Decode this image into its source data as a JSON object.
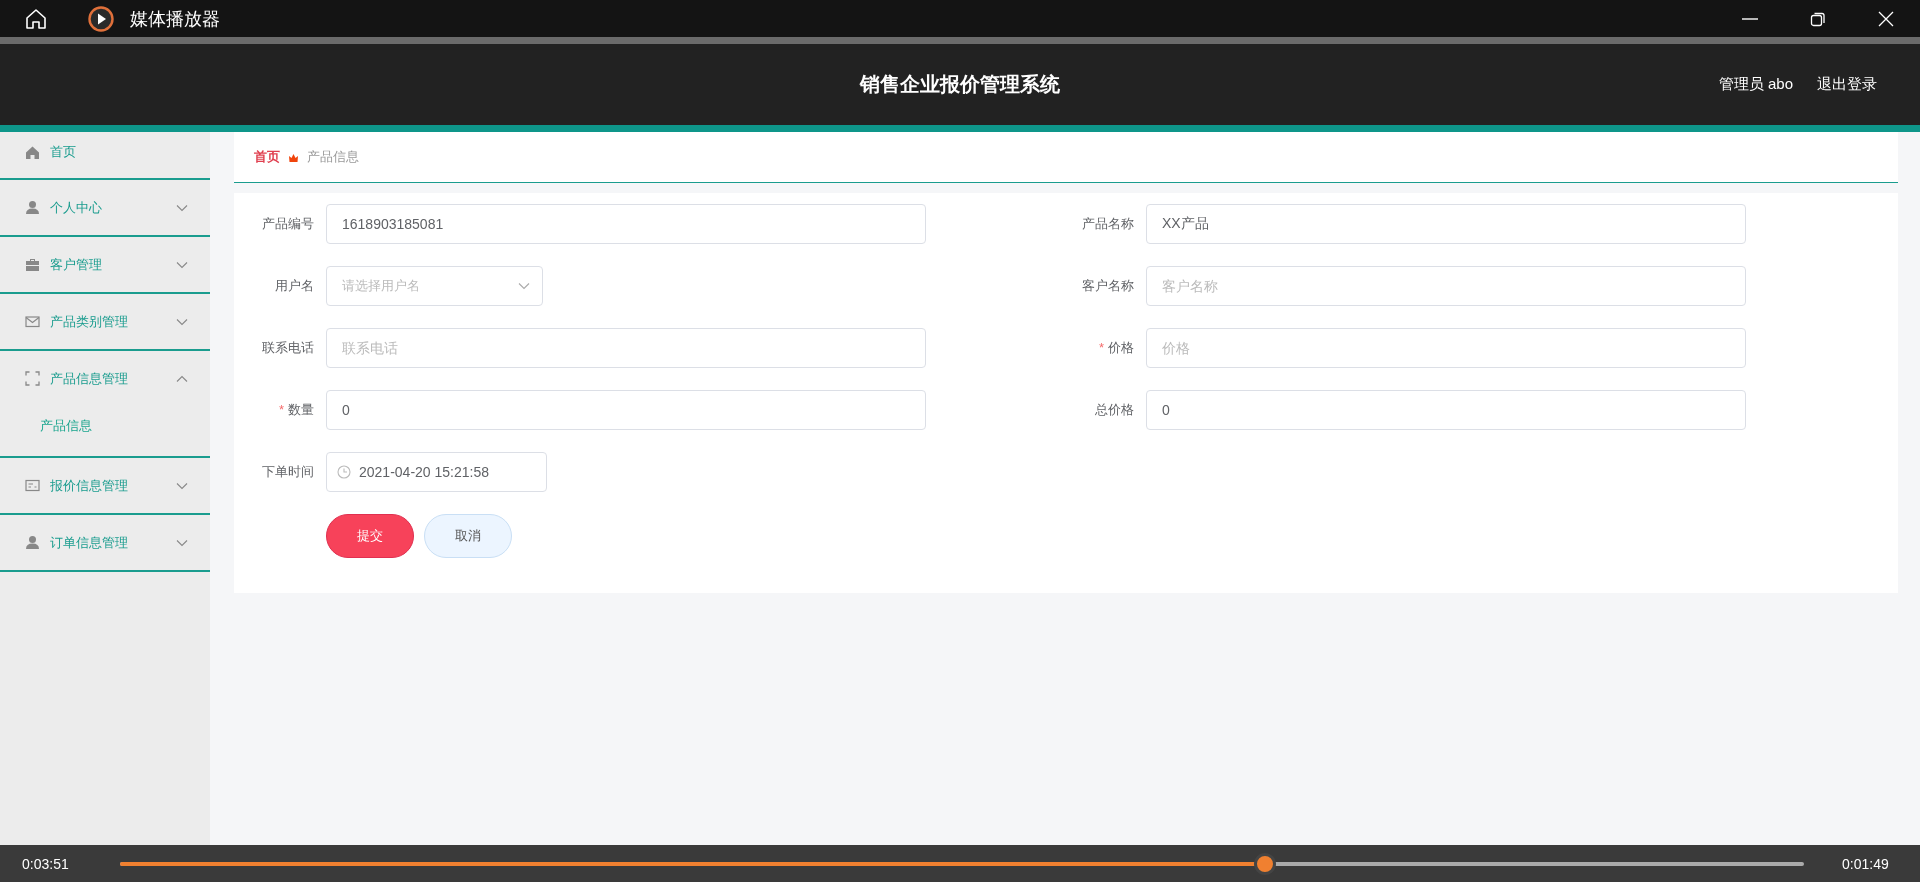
{
  "player": {
    "title": "媒体播放器",
    "time_elapsed": "0:03:51",
    "time_remaining": "0:01:49",
    "progress": {
      "level": 0.68
    }
  },
  "header": {
    "title": "销售企业报价管理系统",
    "user": "管理员 abo",
    "logout": "退出登录"
  },
  "sidebar": {
    "items": [
      {
        "label": "首页",
        "kind": "link"
      },
      {
        "label": "个人中心",
        "kind": "menu",
        "expanded": false
      },
      {
        "label": "客户管理",
        "kind": "menu",
        "expanded": false
      },
      {
        "label": "产品类别管理",
        "kind": "menu",
        "expanded": false
      },
      {
        "label": "产品信息管理",
        "kind": "menu",
        "expanded": true,
        "children": [
          {
            "label": "产品信息"
          }
        ]
      },
      {
        "label": "报价信息管理",
        "kind": "menu",
        "expanded": false
      },
      {
        "label": "订单信息管理",
        "kind": "menu",
        "expanded": false
      }
    ]
  },
  "breadcrumb": [
    {
      "label": "首页",
      "kind": "link"
    },
    {
      "label": "产品信息",
      "kind": "current"
    }
  ],
  "form": {
    "rows": [
      {
        "fields": [
          {
            "label": "产品编号",
            "kind": "text",
            "value": "1618903185081"
          },
          {
            "label": "产品名称",
            "kind": "text",
            "value": "XX产品"
          }
        ]
      },
      {
        "fields": [
          {
            "label": "用户名",
            "kind": "select",
            "placeholder": "请选择用户名"
          },
          {
            "label": "客户名称",
            "kind": "text",
            "placeholder": "客户名称"
          }
        ]
      },
      {
        "fields": [
          {
            "label": "联系电话",
            "kind": "text",
            "placeholder": "联系电话"
          },
          {
            "label": "价格",
            "kind": "text",
            "required_mark": "*",
            "placeholder": "价格"
          }
        ]
      },
      {
        "fields": [
          {
            "label": "数量",
            "kind": "text",
            "required_mark": "*",
            "value": "0"
          },
          {
            "label": "总价格",
            "kind": "text",
            "value": "0"
          }
        ]
      },
      {
        "fields": [
          {
            "label": "下单时间",
            "kind": "date",
            "value": "2021-04-20 15:21:58"
          }
        ]
      }
    ],
    "buttons": [
      {
        "label": "提交",
        "kind": "primary"
      },
      {
        "label": "取消",
        "kind": "secondary"
      }
    ]
  }
}
